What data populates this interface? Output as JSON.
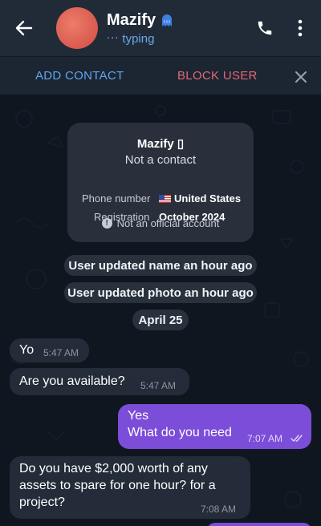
{
  "header": {
    "name": "Mazify",
    "status_dots": "···",
    "status": "typing",
    "back_icon": "arrow-left-icon",
    "call_icon": "phone-icon",
    "menu_icon": "more-vertical-icon",
    "badge_icon": "blue-ghost-emoji-icon"
  },
  "actionbar": {
    "add_contact": "ADD CONTACT",
    "block_user": "BLOCK USER",
    "close_icon": "close-icon"
  },
  "info_card": {
    "name": "Mazify",
    "name_suffix": "▯",
    "status": "Not a contact",
    "phone_label": "Phone number",
    "phone_value": "United States",
    "registration_label": "Registration",
    "registration_value": "October 2024",
    "official": "Not an official account",
    "flag_icon": "us-flag-icon"
  },
  "service_messages": [
    "User updated name an hour ago",
    "User updated photo an hour ago"
  ],
  "date_separator": "April 25",
  "messages": [
    {
      "direction": "in",
      "text": "Yo",
      "time": "5:47 AM"
    },
    {
      "direction": "in",
      "text": "Are you available?",
      "time": "5:47 AM"
    },
    {
      "direction": "out",
      "lines": [
        "Yes",
        "What do you need"
      ],
      "time": "7:07 AM",
      "status": "read"
    },
    {
      "direction": "in",
      "lines": [
        "Do you have $2,000 worth of any",
        "assets to spare for one hour? for a",
        "project?"
      ],
      "time": "7:08 AM"
    }
  ],
  "colors": {
    "header_bg": "#212b38",
    "chat_bg": "#101620",
    "incoming_bubble": "#232c38",
    "outgoing_bubble": "#7b4dd8",
    "accent_blue": "#5fa6ec",
    "danger_red": "#e26a72"
  }
}
